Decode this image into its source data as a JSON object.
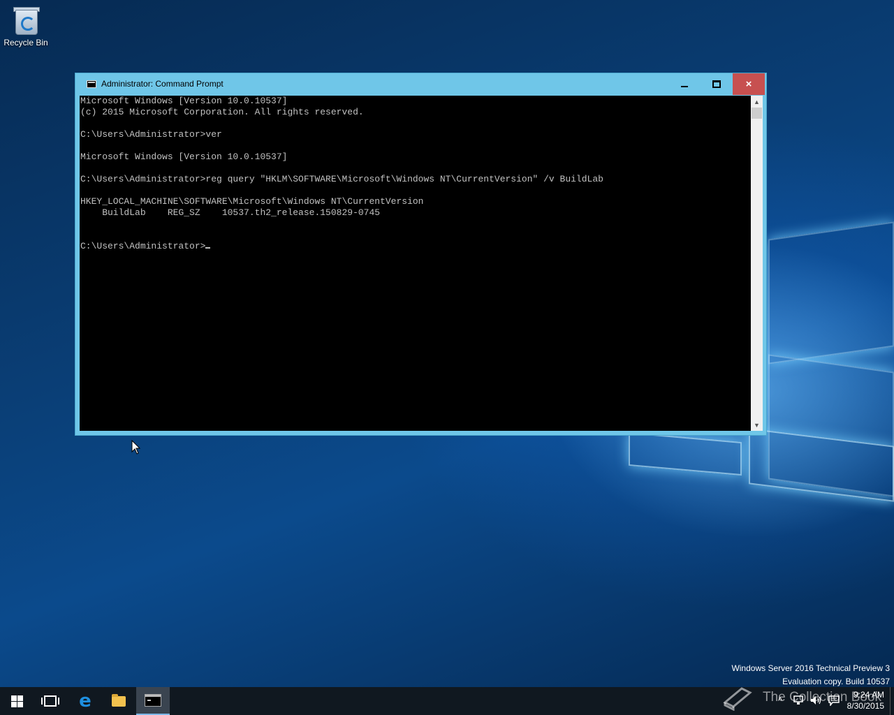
{
  "desktop": {
    "icons": [
      {
        "label": "Recycle Bin",
        "icon": "recycle-bin-icon"
      }
    ],
    "watermark": {
      "line1": "Windows Server 2016 Technical Preview 3",
      "line2": "Evaluation copy. Build 10537"
    },
    "brand_text": "The Collection Book"
  },
  "window": {
    "title": "Administrator: Command Prompt",
    "icon": "command-prompt-icon",
    "controls": {
      "minimize": "minimize-icon",
      "maximize": "maximize-icon",
      "close": "×"
    },
    "console": {
      "lines": [
        "Microsoft Windows [Version 10.0.10537]",
        "(c) 2015 Microsoft Corporation. All rights reserved.",
        "",
        "C:\\Users\\Administrator>ver",
        "",
        "Microsoft Windows [Version 10.0.10537]",
        "",
        "C:\\Users\\Administrator>reg query \"HKLM\\SOFTWARE\\Microsoft\\Windows NT\\CurrentVersion\" /v BuildLab",
        "",
        "HKEY_LOCAL_MACHINE\\SOFTWARE\\Microsoft\\Windows NT\\CurrentVersion",
        "    BuildLab    REG_SZ    10537.th2_release.150829-0745",
        "",
        ""
      ],
      "prompt": "C:\\Users\\Administrator>"
    },
    "scrollbar": {
      "up": "▲",
      "down": "▼"
    }
  },
  "taskbar": {
    "items": [
      {
        "name": "start-button",
        "icon": "windows-logo-icon"
      },
      {
        "name": "task-view-button",
        "icon": "task-view-icon"
      },
      {
        "name": "edge-button",
        "icon": "edge-icon",
        "glyph": "e"
      },
      {
        "name": "file-explorer-button",
        "icon": "folder-icon"
      },
      {
        "name": "command-prompt-taskbar-button",
        "icon": "command-prompt-icon",
        "active": true
      }
    ],
    "tray": {
      "chevron": "^",
      "network": "network-icon",
      "volume": "volume-icon",
      "notifications": "action-center-icon"
    },
    "clock": {
      "time": "9:24 AM",
      "date": "8/30/2015"
    }
  }
}
